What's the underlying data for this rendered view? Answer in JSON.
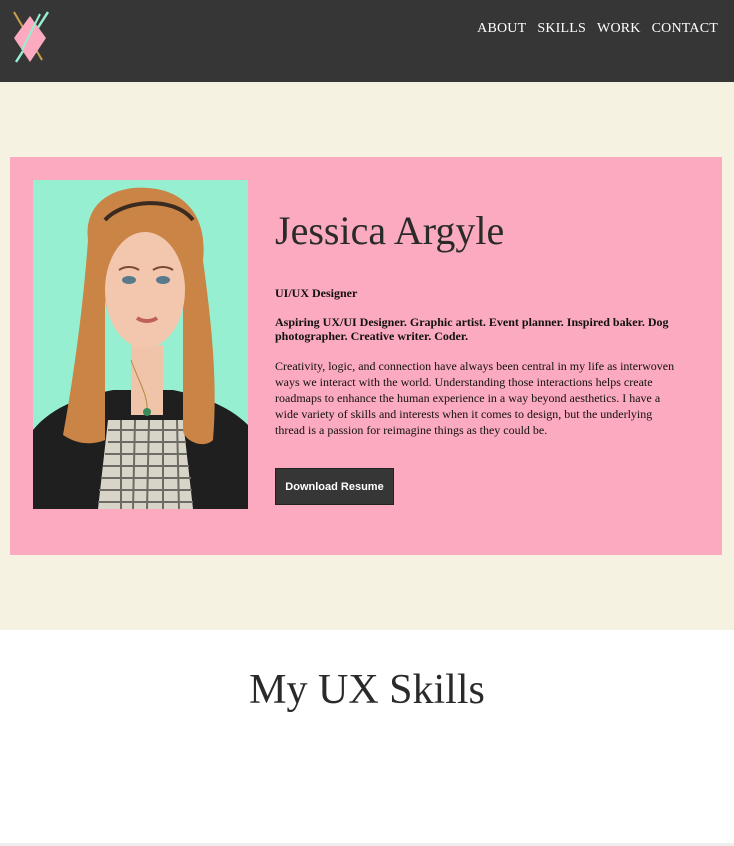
{
  "nav": {
    "items": [
      "ABOUT",
      "SKILLS",
      "WORK",
      "CONTACT"
    ]
  },
  "profile": {
    "name": "Jessica Argyle",
    "role": "UI/UX Designer",
    "tagline": "Aspiring UX/UI Designer. Graphic artist. Event planner. Inspired baker. Dog photographer. Creative writer. Coder.",
    "bio": "Creativity, logic, and connection have always been central in my life as interwoven ways we interact with the world. Understanding those interactions helps create roadmaps to enhance the human experience in a way beyond aesthetics. I have a wide variety of skills and interests when it comes to design, but the underlying thread is a passion for reimagine things as they could be.",
    "button_label": "Download Resume"
  },
  "skills_section": {
    "heading": "My UX Skills"
  },
  "colors": {
    "header_bg": "#363636",
    "hero_bg": "#f6f2e2",
    "card_bg": "#fbaabf",
    "photo_bg": "#97efd1",
    "button_bg": "#363636"
  }
}
